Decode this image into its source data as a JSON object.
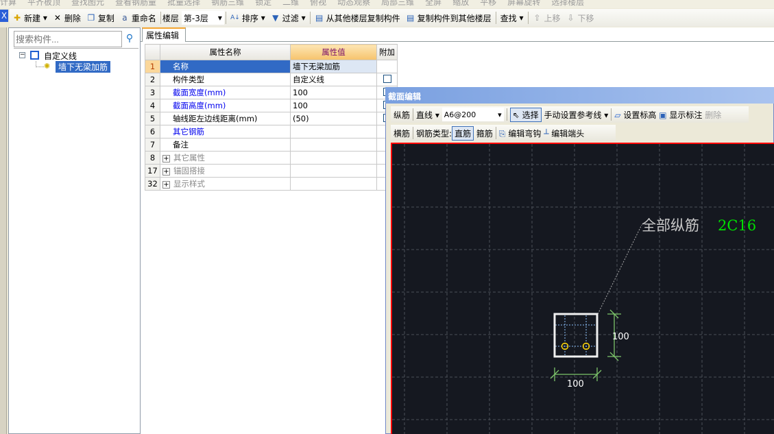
{
  "top_toolbar_cut": [
    "计算",
    "平齐板顶",
    "查找图元",
    "查看钢筋量",
    "批量选择",
    "钢筋三维",
    "锁定",
    "二维",
    "俯视",
    "动态观察",
    "局部三维",
    "全屏",
    "缩放",
    "平移",
    "屏幕旋转",
    "选择楼层"
  ],
  "toolbar": {
    "new": "新建",
    "delete": "删除",
    "copy": "复制",
    "rename": "重命名",
    "floor_label": "楼层",
    "floor_value": "第-3层",
    "sort": "排序",
    "filter": "过滤",
    "copy_from_floor": "从其他楼层复制构件",
    "copy_to_floor": "复制构件到其他楼层",
    "find": "查找",
    "move_up": "上移",
    "move_down": "下移"
  },
  "left_panel": {
    "close": "X",
    "search_placeholder": "搜索构件...",
    "tree": {
      "group": "自定义线",
      "item": "墙下无梁加筋"
    }
  },
  "property_panel": {
    "tab": "属性编辑",
    "headers": [
      "属性名称",
      "属性值",
      "附加"
    ],
    "rows": [
      {
        "no": "1",
        "name": "名称",
        "value": "墙下无梁加筋",
        "style": "selected"
      },
      {
        "no": "2",
        "name": "构件类型",
        "value": "自定义线",
        "check": true
      },
      {
        "no": "3",
        "name": "截面宽度(mm)",
        "value": "100",
        "style": "blue",
        "check": true
      },
      {
        "no": "4",
        "name": "截面高度(mm)",
        "value": "100",
        "style": "blue",
        "check": true
      },
      {
        "no": "5",
        "name": "轴线距左边线距离(mm)",
        "value": "(50)",
        "check": true
      },
      {
        "no": "6",
        "name": "其它钢筋",
        "value": "",
        "style": "blue"
      },
      {
        "no": "7",
        "name": "备注",
        "value": ""
      },
      {
        "no": "8",
        "name": "其它属性",
        "value": "",
        "style": "group"
      },
      {
        "no": "17",
        "name": "锚固搭接",
        "value": "",
        "style": "group"
      },
      {
        "no": "32",
        "name": "显示样式",
        "value": "",
        "style": "group"
      }
    ]
  },
  "section_dialog": {
    "title": "截面编辑",
    "row1": {
      "longitudinal": "纵筋",
      "line": "直线",
      "spec": "A6@200",
      "select": "选择",
      "manual_ref": "手动设置参考线",
      "set_elev": "设置标高",
      "show_label": "显示标注",
      "delete": "删除"
    },
    "row2": {
      "transverse": "横筋",
      "type_label": "钢筋类型:",
      "straight": "直筋",
      "stirrup": "箍筋",
      "edit_hook": "编辑弯钩",
      "edit_end": "编辑端头"
    },
    "canvas": {
      "label": "全部纵筋",
      "label_value": "2C16",
      "dim_width": "100",
      "dim_height": "100",
      "colors": {
        "bg": "#151820",
        "grid": "#4a4f58",
        "label": "#c8c8c8",
        "value": "#00e000",
        "dim": "#7cc46a",
        "rebar": "#ffd400"
      }
    }
  }
}
